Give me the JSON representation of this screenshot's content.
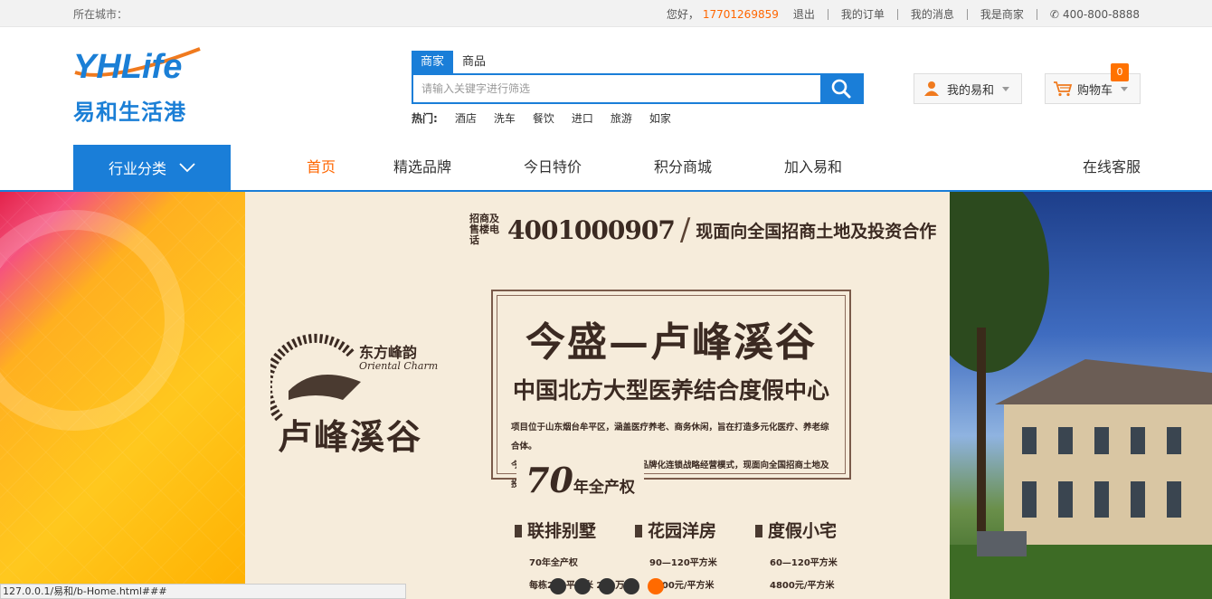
{
  "topbar": {
    "city_label": "所在城市：",
    "greeting": "您好，",
    "phone": "17701269859",
    "logout": "退出",
    "my_orders": "我的订单",
    "my_messages": "我的消息",
    "merchant": "我是商家",
    "hotline": "400-800-8888"
  },
  "logo": {
    "latin": "YHLife",
    "chinese": "易和生活港"
  },
  "search": {
    "tabs": [
      "商家",
      "商品"
    ],
    "active_tab": "商家",
    "placeholder": "请输入关键字进行筛选",
    "hot_label": "热门:",
    "hot": [
      "酒店",
      "洗车",
      "餐饮",
      "进口",
      "旅游",
      "如家"
    ]
  },
  "header": {
    "my_yihe": "我的易和",
    "cart": "购物车",
    "cart_count": "0"
  },
  "nav": {
    "category": "行业分类",
    "items": [
      "首页",
      "精选品牌",
      "今日特价",
      "积分商城",
      "加入易和"
    ],
    "active": "首页",
    "service": "在线客服"
  },
  "banner": {
    "tel_label": "招商及售楼电话",
    "tel": "4001000907",
    "tel_desc": "现面向全国招商土地及投资合作",
    "title": "今盛—卢峰溪谷",
    "subtitle": "中国北方大型医养结合度假中心",
    "desc1": "项目位于山东烟台牟平区，涵盖医疗养老、商务休闲，旨在打造多元化医疗、养老综合体。",
    "desc2": "今盛—卢峰溪谷旅游度假综合体、品牌化连锁战略经营模式，现面向全国招商土地及投资合作。",
    "years": "70",
    "years_suffix": "年全产权",
    "brand_cn": "东方峰韵",
    "brand_en": "Oriental Charm",
    "brand_name": "卢峰溪谷",
    "types": [
      {
        "name": "联排别墅",
        "line1": "70年全产权",
        "line2": "每栋240平方米  220万"
      },
      {
        "name": "花园洋房",
        "line1": "90—120平方米",
        "line2": "5800元/平方米"
      },
      {
        "name": "度假小宅",
        "line1": "60—120平方米",
        "line2": "4800元/平方米"
      }
    ],
    "slides": 5,
    "active_slide": 5
  },
  "status_url": "127.0.0.1/易和/b-Home.html###",
  "colors": {
    "brand_blue": "#1a7ed8",
    "accent_orange": "#ff6600"
  }
}
